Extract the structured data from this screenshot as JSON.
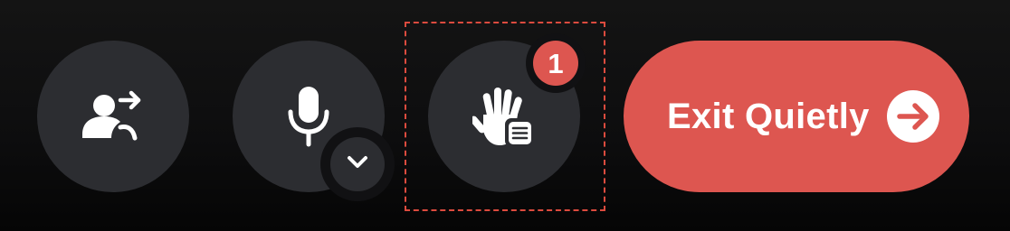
{
  "toolbar": {
    "share_button": {
      "icon": "user-share-icon"
    },
    "mic_button": {
      "icon": "microphone-icon",
      "dropdown_icon": "chevron-down-icon"
    },
    "raise_hand_button": {
      "icon": "raise-hand-list-icon",
      "badge_count": "1"
    },
    "exit_button": {
      "label": "Exit Quietly",
      "icon": "arrow-right-circle-icon"
    }
  },
  "colors": {
    "background": "#0d0d0e",
    "round_button": "#2c2d31",
    "accent_red": "#dd5650",
    "focus_ring": "#dc4b3e",
    "icon": "#ffffff"
  }
}
